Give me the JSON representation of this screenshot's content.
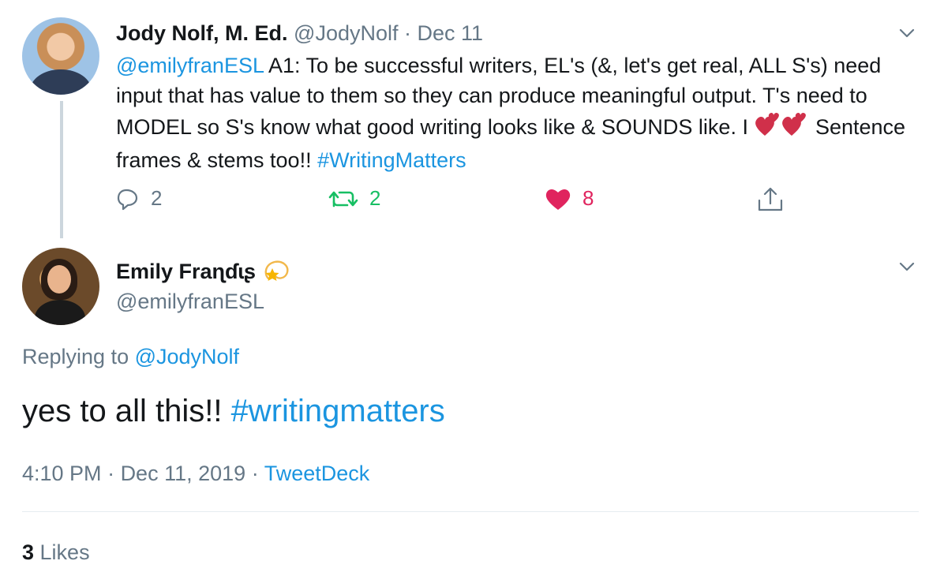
{
  "parent_tweet": {
    "author_name": "Jody Nolf, M. Ed.",
    "author_handle": "@JodyNolf",
    "separator": "·",
    "date": "Dec 11",
    "mention": "@emilyfranESL",
    "text_line1": " A1: To be successful writers, EL's (&, let's get real, ALL S's) need input that has value to them so they can produce meaningful output. T's need to MODEL so S's know what good writing looks like & SOUNDS like. I ",
    "text_after_emoji": " Sentence frames & stems too!! ",
    "hashtag": "#WritingMatters",
    "emoji_icon": "two-hearts-emoji",
    "reply_count": "2",
    "retweet_count": "2",
    "like_count": "8"
  },
  "reply_tweet": {
    "author_name": "Emily Fraɳɗɩʂ",
    "author_emoji": "dizzy-star-emoji",
    "author_handle": "@emilyfranESL",
    "replying_prefix": "Replying to ",
    "replying_handle": "@JodyNolf",
    "text": "yes to all this!! ",
    "hashtag": "#writingmatters",
    "time": "4:10 PM",
    "separator": " · ",
    "date": "Dec 11, 2019",
    "source": "TweetDeck",
    "likes_count": "3",
    "likes_label": " Likes"
  },
  "colors": {
    "link": "#1b95e0",
    "muted": "#657786",
    "retweet_green": "#17bf63",
    "like_red": "#e0245e",
    "text": "#14171a"
  }
}
